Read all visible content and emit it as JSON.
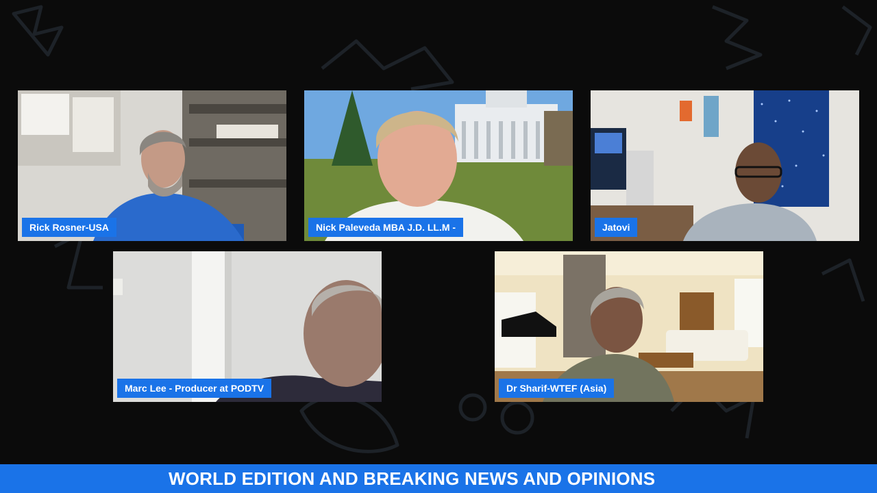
{
  "participants": [
    {
      "name": "Rick Rosner-USA"
    },
    {
      "name": "Nick Paleveda MBA J.D. LL.M -"
    },
    {
      "name": "Jatovi"
    },
    {
      "name": "Marc Lee - Producer at PODTV"
    },
    {
      "name": "Dr Sharif-WTEF (Asia)"
    }
  ],
  "ticker": {
    "text": "WORLD EDITION AND BREAKING NEWS AND OPINIONS"
  },
  "colors": {
    "accent": "#1a73e8",
    "background": "#0b0b0b"
  }
}
